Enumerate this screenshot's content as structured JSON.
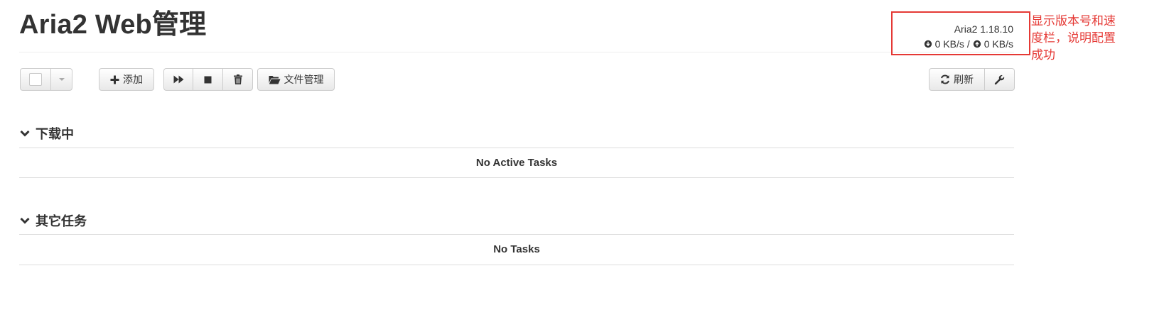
{
  "header": {
    "title": "Aria2 Web管理",
    "version": "Aria2 1.18.10",
    "download_speed": "0 KB/s",
    "speed_separator": "/",
    "upload_speed": "0 KB/s"
  },
  "annotation": {
    "text": "显示版本号和速度栏，说明配置成功",
    "color": "#e53935"
  },
  "toolbar": {
    "select_checkbox_icon": "checkbox-icon",
    "select_dropdown_icon": "caret-down-icon",
    "add_label": "添加",
    "add_icon": "plus-icon",
    "resume_icon": "fast-forward-icon",
    "stop_icon": "stop-icon",
    "delete_icon": "trash-icon",
    "file_manager_label": "文件管理",
    "file_manager_icon": "folder-open-icon",
    "refresh_label": "刷新",
    "refresh_icon": "refresh-icon",
    "settings_icon": "wrench-icon"
  },
  "sections": {
    "downloading": {
      "title": "下载中",
      "empty_message": "No Active Tasks"
    },
    "other": {
      "title": "其它任务",
      "empty_message": "No Tasks"
    }
  }
}
